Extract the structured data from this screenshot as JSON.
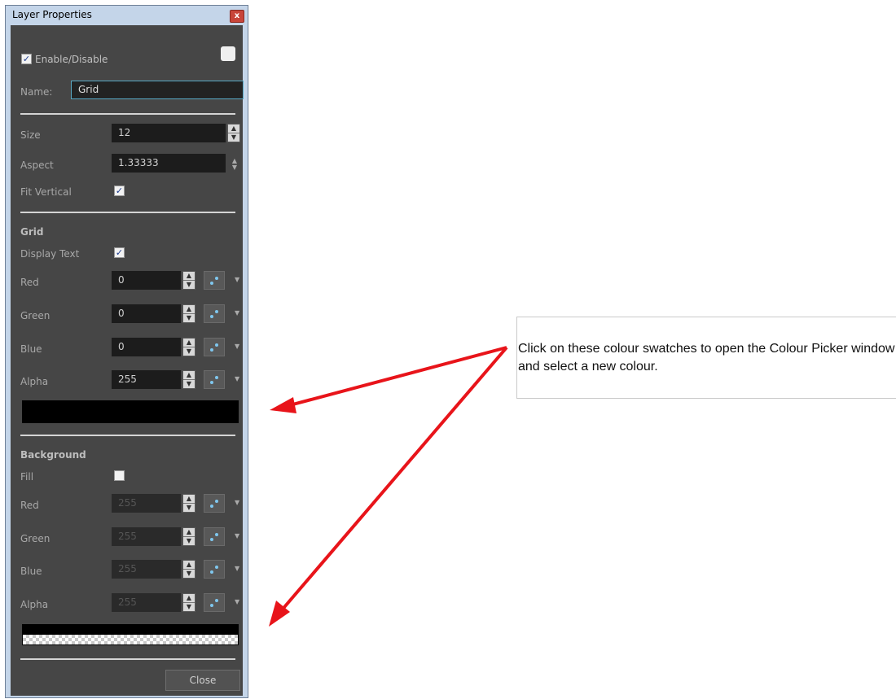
{
  "window": {
    "title": "Layer Properties",
    "close_glyph": "x"
  },
  "top": {
    "enable_label": "Enable/Disable",
    "enable_checked": true,
    "name_label": "Name:",
    "name_value": "Grid"
  },
  "size": {
    "label": "Size",
    "value": "12"
  },
  "aspect": {
    "label": "Aspect",
    "value": "1.33333"
  },
  "fit_vertical": {
    "label": "Fit Vertical",
    "checked": true
  },
  "grid": {
    "heading": "Grid",
    "display_text_label": "Display Text",
    "display_text_checked": true,
    "channels": [
      {
        "label": "Red",
        "value": "0"
      },
      {
        "label": "Green",
        "value": "0"
      },
      {
        "label": "Blue",
        "value": "0"
      },
      {
        "label": "Alpha",
        "value": "255"
      }
    ],
    "swatch_color": "#000000"
  },
  "background": {
    "heading": "Background",
    "fill_label": "Fill",
    "fill_checked": false,
    "channels": [
      {
        "label": "Red",
        "value": "255"
      },
      {
        "label": "Green",
        "value": "255"
      },
      {
        "label": "Blue",
        "value": "255"
      },
      {
        "label": "Alpha",
        "value": "255"
      }
    ]
  },
  "close_button": "Close",
  "callout": {
    "text": "Click on these colour swatches to open the Colour Picker window and select a new colour."
  },
  "colors": {
    "panel": "#464646",
    "arrow": "#e8141a",
    "picker_dot": "#7fc7ee"
  },
  "icons": {
    "spin": "spin-arrows-icon",
    "picker": "color-picker-icon",
    "dropdown": "chevron-down-icon",
    "check": "check-icon"
  }
}
